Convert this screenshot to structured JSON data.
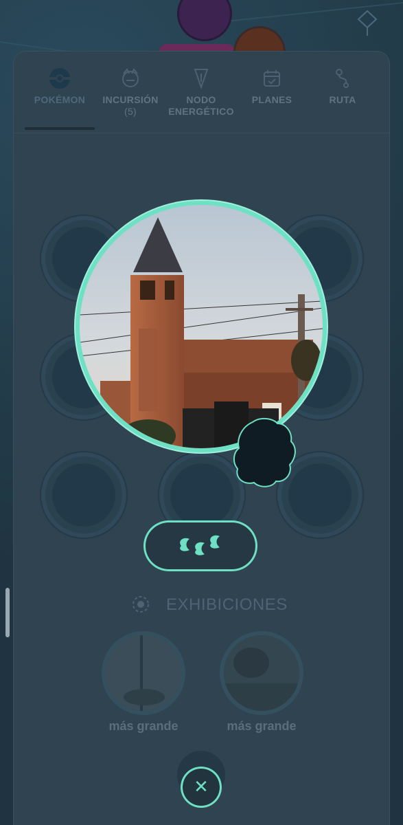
{
  "tabs": [
    {
      "id": "pokemon",
      "label": "POKÉMON",
      "icon": "pokeball-icon",
      "active": true
    },
    {
      "id": "incursion",
      "label": "INCURSIÓN",
      "sublabel": "(5)",
      "icon": "raid-boss-icon",
      "active": false
    },
    {
      "id": "nodo",
      "label": "NODO",
      "sublabel": "ENERGÉTICO",
      "icon": "power-spot-icon",
      "active": false
    },
    {
      "id": "planes",
      "label": "PLANES",
      "icon": "calendar-icon",
      "active": false
    },
    {
      "id": "ruta",
      "label": "RUTA",
      "icon": "route-icon",
      "active": false
    }
  ],
  "egg_button": {
    "icon": "footprints-icon"
  },
  "exhibitions": {
    "title": "EXHIBICIONES",
    "items": [
      {
        "label": "más grande"
      },
      {
        "label": "más grande"
      }
    ]
  },
  "close": {
    "label": "✕"
  },
  "colors": {
    "accent": "#6ee0c4",
    "panel": "#2f4350",
    "text_dim": "#5f7480"
  }
}
